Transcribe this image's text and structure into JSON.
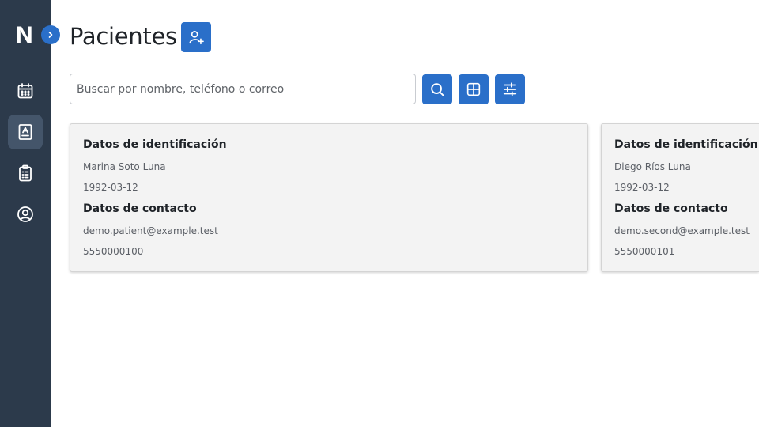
{
  "app": {
    "logo_letter": "N",
    "brand_color": "#2a6fc9",
    "sidebar_color": "#2c3a4b"
  },
  "sidebar": {
    "expand_icon": "chevron-right-icon",
    "items": [
      {
        "name": "calendar",
        "icon": "calendar-icon",
        "active": false
      },
      {
        "name": "patients",
        "icon": "contact-book-icon",
        "active": true
      },
      {
        "name": "clipboard",
        "icon": "clipboard-list-icon",
        "active": false
      },
      {
        "name": "profile",
        "icon": "user-circle-icon",
        "active": false
      }
    ]
  },
  "header": {
    "title": "Pacientes",
    "add_icon": "user-plus-icon"
  },
  "search": {
    "placeholder": "Buscar por nombre, teléfono o correo",
    "value": "",
    "search_icon": "search-icon",
    "grid_icon": "grid-icon",
    "filter_icon": "sliders-icon"
  },
  "patients": [
    {
      "identification_heading": "Datos de identificación",
      "name": "Marina Soto Luna",
      "birth_date": "1992-03-12",
      "contact_heading": "Datos de contacto",
      "email": "demo.patient@example.test",
      "phone": "5550000100"
    },
    {
      "identification_heading": "Datos de identificación",
      "name": "Diego Ríos Luna",
      "birth_date": "1992-03-12",
      "contact_heading": "Datos de contacto",
      "email": "demo.second@example.test",
      "phone": "5550000101"
    }
  ]
}
